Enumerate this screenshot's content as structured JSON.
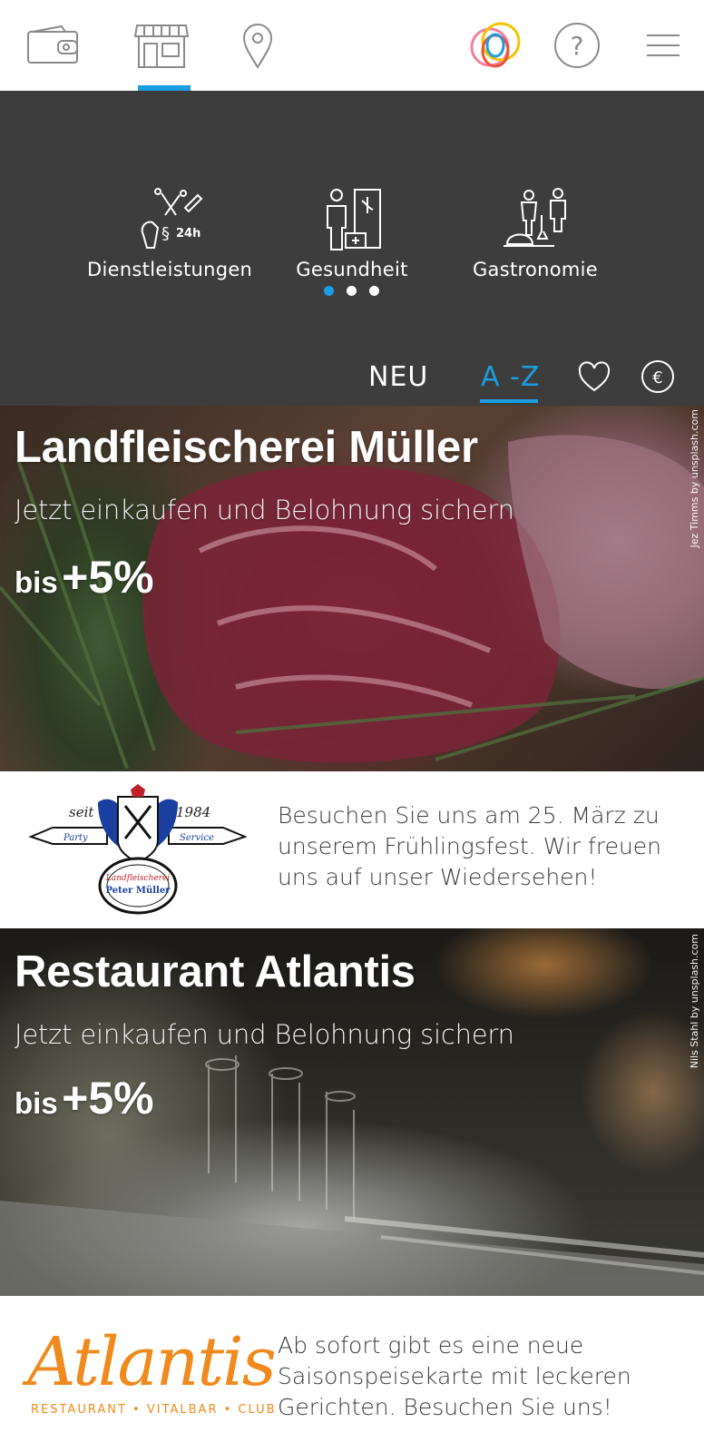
{
  "nav": {
    "icons": [
      "wallet-icon",
      "store-icon",
      "location-pin-icon",
      "brand-logo-icon",
      "help-icon",
      "hamburger-menu-icon"
    ],
    "help_glyph": "?",
    "accent_color": "#1b9de2"
  },
  "categories": {
    "items": [
      {
        "label": "Dienstleistungen",
        "icon": "services-tools-icon",
        "badge": "24h"
      },
      {
        "label": "Gesundheit",
        "icon": "health-doctor-icon"
      },
      {
        "label": "Gastronomie",
        "icon": "gastronomy-dining-icon"
      }
    ],
    "pager": {
      "count": 3,
      "active": 1
    },
    "background": "#3d3d3d"
  },
  "sort": {
    "new_label": "NEU",
    "az_label": "A -Z",
    "favorites_icon": "heart-icon",
    "price_icon": "euro-icon",
    "euro_glyph": "€",
    "active": "A -Z"
  },
  "merchants": [
    {
      "name": "Landfleischerei Müller",
      "tagline": "Jetzt einkaufen und Belohnung sichern",
      "reward_prefix": "bis",
      "reward_value": "+5%",
      "photo_credit": "Jez Timms by unsplash.com",
      "logo": {
        "seit": "seit",
        "year": "1984",
        "left_banner": "Party",
        "right_banner": "Service",
        "shop": "Landfleischerei",
        "owner": "Peter Müller"
      },
      "message": "Besuchen Sie uns am 25. März zu unserem Frühlingsfest. Wir freuen uns auf unser Wiedersehen!"
    },
    {
      "name": "Restaurant Atlantis",
      "tagline": "Jetzt einkaufen und Belohnung sichern",
      "reward_prefix": "bis",
      "reward_value": "+5%",
      "photo_credit": "Nils Stahl by unsplash.com",
      "logo": {
        "wordmark": "Atlantis",
        "tagline": "RESTAURANT • VITALBAR • CLUB",
        "color": "#f08a1c"
      },
      "message": "Ab sofort gibt es eine neue Saisonspeisekarte mit leckeren Gerichten. Besuchen Sie uns!"
    }
  ]
}
